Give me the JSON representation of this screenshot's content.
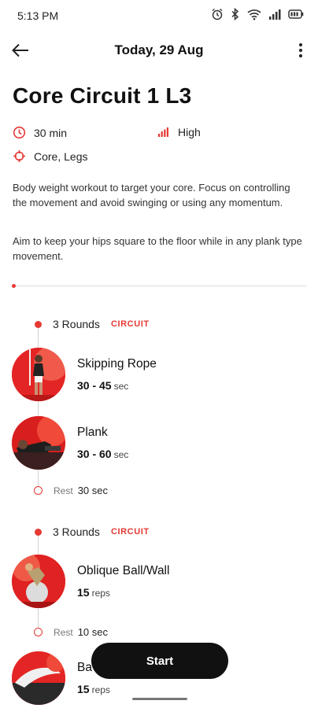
{
  "status_bar": {
    "time": "5:13 PM",
    "icons": [
      "alarm-icon",
      "bluetooth-icon",
      "wifi-icon",
      "signal-icon",
      "battery-icon"
    ]
  },
  "header": {
    "title": "Today, 29 Aug"
  },
  "workout": {
    "title": "Core Circuit 1 L3",
    "duration": "30 min",
    "intensity": "High",
    "focus": "Core, Legs",
    "description_1": "Body weight workout to target your core. Focus on controlling the movement and avoid swinging or using any momentum.",
    "description_2": "Aim to keep your hips square to the floor while in any plank type movement."
  },
  "progress": 0,
  "blocks": [
    {
      "rounds_label": "3 Rounds",
      "type_label": "CIRCUIT",
      "exercises": [
        {
          "name": "Skipping Rope",
          "amount": "30 - 45",
          "unit": "sec"
        },
        {
          "name": "Plank",
          "amount": "30 - 60",
          "unit": "sec"
        }
      ],
      "rest": {
        "label": "Rest",
        "value": "30 sec"
      }
    },
    {
      "rounds_label": "3 Rounds",
      "type_label": "CIRCUIT",
      "exercises": [
        {
          "name": "Oblique Ball/Wall",
          "amount": "15",
          "unit": "reps"
        }
      ],
      "rest": {
        "label": "Rest",
        "value": "10 sec"
      }
    }
  ],
  "partial_exercise": {
    "name": "Ba",
    "amount": "15",
    "unit": "reps"
  },
  "start_button": {
    "label": "Start"
  },
  "colors": {
    "accent": "#e53935",
    "button": "#111111",
    "background": "#ffffff"
  }
}
